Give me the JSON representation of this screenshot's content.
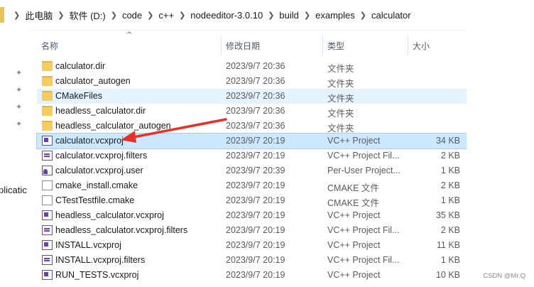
{
  "breadcrumb": [
    "此电脑",
    "软件 (D:)",
    "code",
    "c++",
    "nodeeditor-3.0.10",
    "build",
    "examples",
    "calculator"
  ],
  "sidebar": {
    "partial_label": "plicatic"
  },
  "columns": {
    "name": "名称",
    "date": "修改日期",
    "type": "类型",
    "size": "大小"
  },
  "files": [
    {
      "name": "calculator.dir",
      "date": "2023/9/7 20:36",
      "type": "文件夹",
      "size": "",
      "icon": "folder-icon"
    },
    {
      "name": "calculator_autogen",
      "date": "2023/9/7 20:36",
      "type": "文件夹",
      "size": "",
      "icon": "folder-icon"
    },
    {
      "name": "CMakeFiles",
      "date": "2023/9/7 20:36",
      "type": "文件夹",
      "size": "",
      "icon": "folder-icon"
    },
    {
      "name": "headless_calculator.dir",
      "date": "2023/9/7 20:36",
      "type": "文件夹",
      "size": "",
      "icon": "folder-icon"
    },
    {
      "name": "headless_calculator_autogen",
      "date": "2023/9/7 20:36",
      "type": "文件夹",
      "size": "",
      "icon": "folder-icon"
    },
    {
      "name": "calculator.vcxproj",
      "date": "2023/9/7 20:19",
      "type": "VC++ Project",
      "size": "34 KB",
      "icon": "vcxproj-icon"
    },
    {
      "name": "calculator.vcxproj.filters",
      "date": "2023/9/7 20:19",
      "type": "VC++ Project Fil...",
      "size": "2 KB",
      "icon": "filters-icon"
    },
    {
      "name": "calculator.vcxproj.user",
      "date": "2023/9/7 20:39",
      "type": "Per-User Project...",
      "size": "1 KB",
      "icon": "user-file-icon"
    },
    {
      "name": "cmake_install.cmake",
      "date": "2023/9/7 20:19",
      "type": "CMAKE 文件",
      "size": "2 KB",
      "icon": "document-icon"
    },
    {
      "name": "CTestTestfile.cmake",
      "date": "2023/9/7 20:19",
      "type": "CMAKE 文件",
      "size": "1 KB",
      "icon": "document-icon"
    },
    {
      "name": "headless_calculator.vcxproj",
      "date": "2023/9/7 20:19",
      "type": "VC++ Project",
      "size": "35 KB",
      "icon": "vcxproj-icon"
    },
    {
      "name": "headless_calculator.vcxproj.filters",
      "date": "2023/9/7 20:19",
      "type": "VC++ Project Fil...",
      "size": "2 KB",
      "icon": "filters-icon"
    },
    {
      "name": "INSTALL.vcxproj",
      "date": "2023/9/7 20:19",
      "type": "VC++ Project",
      "size": "11 KB",
      "icon": "vcxproj-icon"
    },
    {
      "name": "INSTALL.vcxproj.filters",
      "date": "2023/9/7 20:19",
      "type": "VC++ Project Fil...",
      "size": "1 KB",
      "icon": "filters-icon"
    },
    {
      "name": "RUN_TESTS.vcxproj",
      "date": "2023/9/7 20:19",
      "type": "VC++ Project",
      "size": "10 KB",
      "icon": "vcxproj-icon"
    }
  ],
  "state": {
    "selected_row": 5,
    "hover_row": 2
  },
  "annotation": {
    "arrow_color": "#e8302a"
  },
  "watermark": "CSDN @Mr.Q"
}
